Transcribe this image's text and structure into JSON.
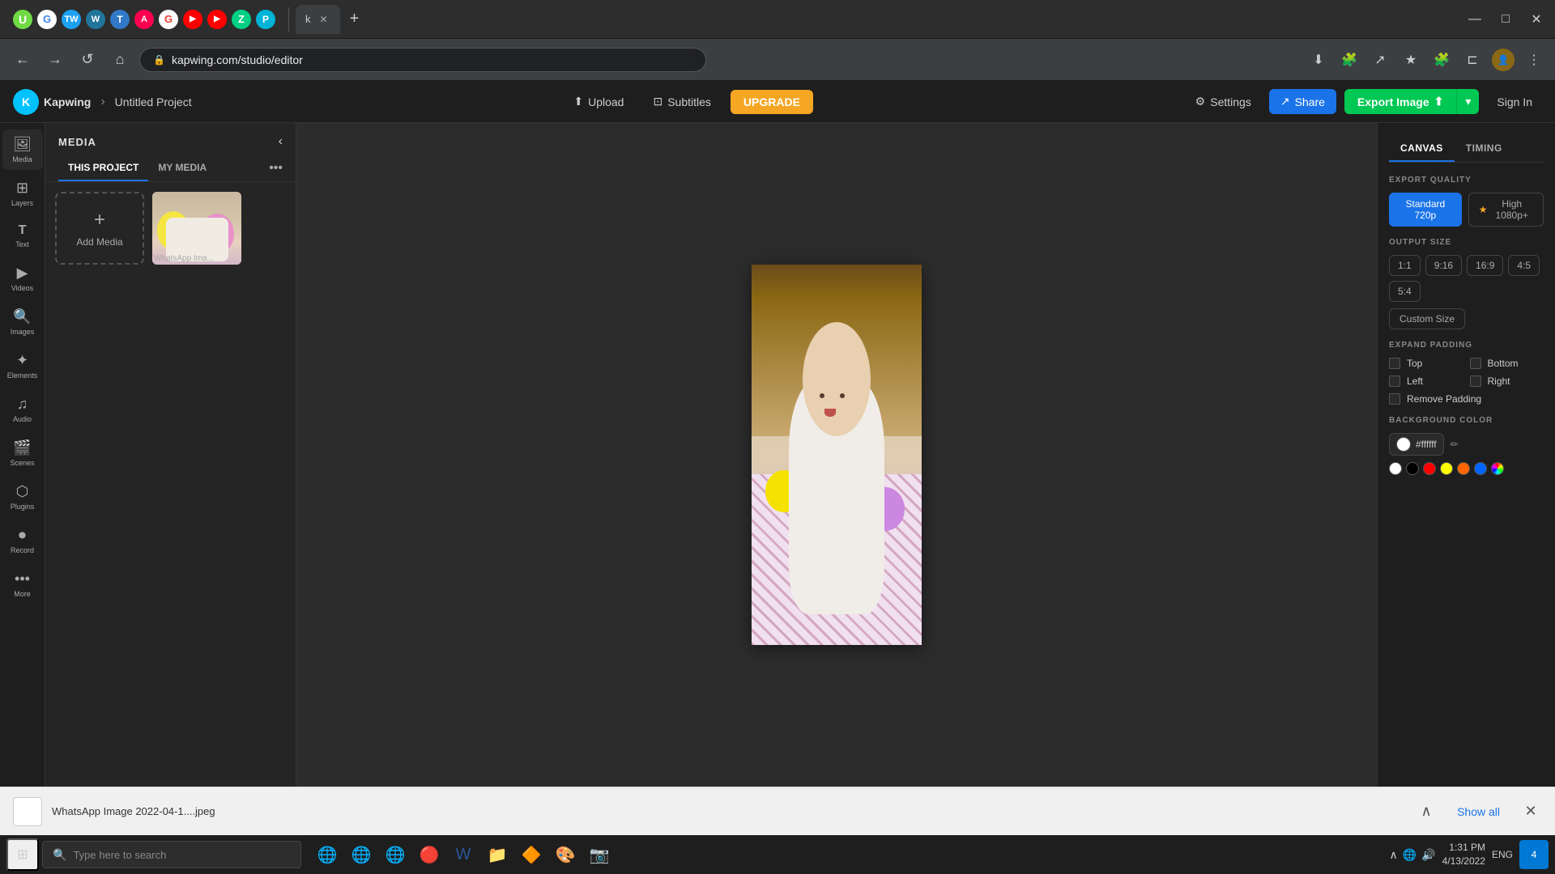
{
  "browser": {
    "tabs": [
      {
        "label": "U",
        "favicon_class": "fav-upwork"
      },
      {
        "label": "G",
        "favicon_class": "fav-g"
      },
      {
        "label": "TW",
        "favicon_class": "fav-tw"
      },
      {
        "label": "W",
        "favicon_class": "fav-wp"
      },
      {
        "label": "T",
        "favicon_class": "fav-t"
      },
      {
        "label": "A",
        "favicon_class": "fav-ani"
      },
      {
        "label": "G",
        "favicon_class": "fav-g2"
      },
      {
        "label": "▶",
        "favicon_class": "fav-yt"
      },
      {
        "label": "▶",
        "favicon_class": "fav-yt2"
      },
      {
        "label": "Z",
        "favicon_class": "fav-z"
      },
      {
        "label": "P",
        "favicon_class": "fav-p"
      }
    ],
    "active_tab_label": "k",
    "url": "kapwing.com/studio/editor",
    "new_tab_icon": "+",
    "win_minimize": "—",
    "win_maximize": "□",
    "win_close": "✕"
  },
  "app": {
    "logo_letter": "K",
    "brand_name": "Kapwing",
    "breadcrumb_sep": "›",
    "project_name": "Untitled Project",
    "header": {
      "upload_label": "Upload",
      "subtitles_label": "Subtitles",
      "upgrade_label": "UPGRADE",
      "settings_label": "Settings",
      "share_label": "Share",
      "export_label": "Export Image",
      "signin_label": "Sign In"
    },
    "left_sidebar": {
      "items": [
        {
          "icon": "🖼️",
          "label": "Media"
        },
        {
          "icon": "⊞",
          "label": "Layers"
        },
        {
          "icon": "T",
          "label": "Text"
        },
        {
          "icon": "▶",
          "label": "Videos"
        },
        {
          "icon": "🔍",
          "label": "Images"
        },
        {
          "icon": "✦",
          "label": "Elements"
        },
        {
          "icon": "♪",
          "label": "Audio"
        },
        {
          "icon": "🎬",
          "label": "Scenes"
        },
        {
          "icon": "🔌",
          "label": "Plugins"
        },
        {
          "icon": "⏺",
          "label": "Record"
        },
        {
          "icon": "•••",
          "label": "More"
        }
      ]
    },
    "media_panel": {
      "title": "MEDIA",
      "tab_this_project": "THIS PROJECT",
      "tab_my_media": "MY MEDIA",
      "add_media_label": "Add Media",
      "media_items": [
        {
          "label": "WhatsApp Ima..."
        }
      ]
    },
    "right_panel": {
      "tab_canvas": "CANVAS",
      "tab_timing": "TIMING",
      "export_quality_label": "EXPORT QUALITY",
      "quality_standard": "Standard 720p",
      "quality_high": "High 1080p+",
      "output_size_label": "OUTPUT SIZE",
      "sizes": [
        "1:1",
        "9:16",
        "16:9",
        "4:5",
        "5:4"
      ],
      "custom_size_label": "Custom Size",
      "expand_padding_label": "EXPAND PADDING",
      "padding_top": "Top",
      "padding_bottom": "Bottom",
      "padding_left": "Left",
      "padding_right": "Right",
      "remove_padding_label": "Remove Padding",
      "bg_color_label": "BACKGROUND COLOR",
      "bg_color_hex": "#ffffff",
      "swatches": [
        "#fff",
        "#000",
        "#ff0000",
        "#ffff00",
        "#ff6600",
        "#0000ff",
        "gradient"
      ]
    }
  },
  "bottom_bar": {
    "file_name": "WhatsApp Image 2022-04-1....jpeg",
    "show_all_label": "Show all",
    "collapse_icon": "∧"
  },
  "taskbar": {
    "search_placeholder": "Type here to search",
    "apps": [
      "🌐",
      "🌐",
      "🌐",
      "🌐",
      "📁",
      "🎨"
    ],
    "clock_time": "1:31 PM",
    "clock_date": "4/13/2022",
    "notification_badge": "4",
    "lang": "ENG"
  }
}
